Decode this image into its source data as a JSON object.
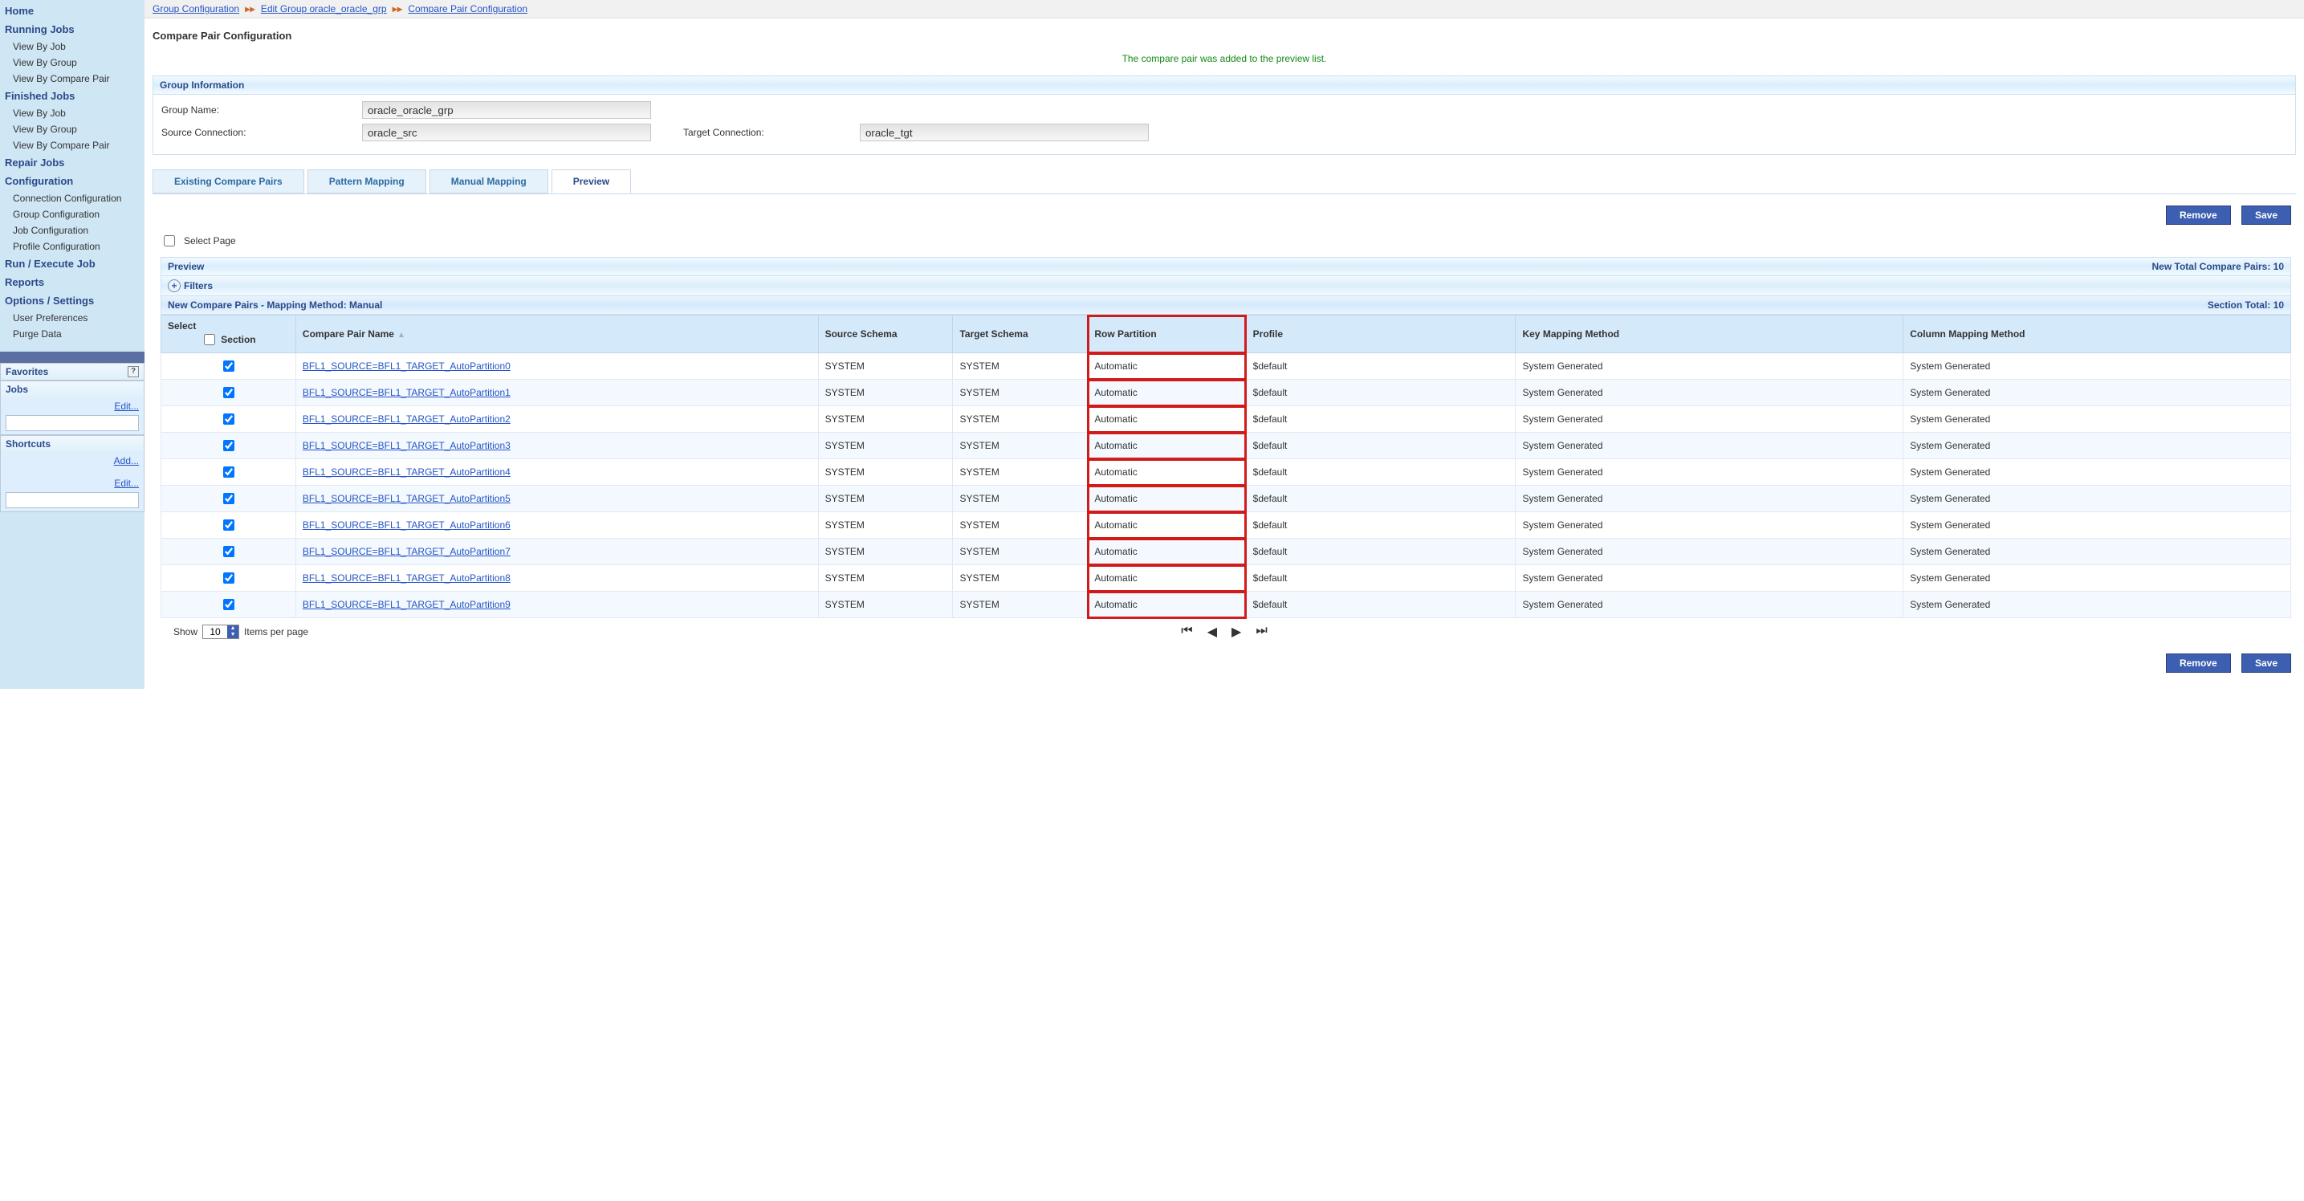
{
  "nav": {
    "home": "Home",
    "running": "Running Jobs",
    "running_items": [
      "View By Job",
      "View By Group",
      "View By Compare Pair"
    ],
    "finished": "Finished Jobs",
    "finished_items": [
      "View By Job",
      "View By Group",
      "View By Compare Pair"
    ],
    "repair": "Repair Jobs",
    "config": "Configuration",
    "config_items": [
      "Connection Configuration",
      "Group Configuration",
      "Job Configuration",
      "Profile Configuration"
    ],
    "run": "Run / Execute Job",
    "reports": "Reports",
    "options": "Options / Settings",
    "options_items": [
      "User Preferences",
      "Purge Data"
    ]
  },
  "side": {
    "favorites": "Favorites",
    "jobs": "Jobs",
    "edit": "Edit...",
    "shortcuts": "Shortcuts",
    "add": "Add..."
  },
  "breadcrumb": {
    "a": "Group Configuration",
    "b": "Edit Group oracle_oracle_grp",
    "c": "Compare Pair Configuration"
  },
  "page_title": "Compare Pair Configuration",
  "notice": "The compare pair was added to the preview list.",
  "group_section": "Group Information",
  "labels": {
    "group_name": "Group Name:",
    "source_conn": "Source Connection:",
    "target_conn": "Target Connection:"
  },
  "values": {
    "group_name": "oracle_oracle_grp",
    "source_conn": "oracle_src",
    "target_conn": "oracle_tgt"
  },
  "tabs": {
    "existing": "Existing Compare Pairs",
    "pattern": "Pattern Mapping",
    "manual": "Manual Mapping",
    "preview": "Preview"
  },
  "buttons": {
    "remove": "Remove",
    "save": "Save"
  },
  "select_page": "Select Page",
  "preview_bar": {
    "left": "Preview",
    "right": "New Total Compare Pairs: 10"
  },
  "filters": "Filters",
  "subhead": {
    "left": "New Compare Pairs - Mapping Method: Manual",
    "right": "Section Total: 10"
  },
  "cols": {
    "select": "Select",
    "section": "Section",
    "name": "Compare Pair Name",
    "src": "Source Schema",
    "tgt": "Target Schema",
    "rp": "Row Partition",
    "profile": "Profile",
    "km": "Key Mapping Method",
    "cm": "Column Mapping Method"
  },
  "rows": [
    {
      "name": "BFL1_SOURCE=BFL1_TARGET_AutoPartition0",
      "src": "SYSTEM",
      "tgt": "SYSTEM",
      "rp": "Automatic",
      "profile": "$default",
      "km": "System Generated",
      "cm": "System Generated"
    },
    {
      "name": "BFL1_SOURCE=BFL1_TARGET_AutoPartition1",
      "src": "SYSTEM",
      "tgt": "SYSTEM",
      "rp": "Automatic",
      "profile": "$default",
      "km": "System Generated",
      "cm": "System Generated"
    },
    {
      "name": "BFL1_SOURCE=BFL1_TARGET_AutoPartition2",
      "src": "SYSTEM",
      "tgt": "SYSTEM",
      "rp": "Automatic",
      "profile": "$default",
      "km": "System Generated",
      "cm": "System Generated"
    },
    {
      "name": "BFL1_SOURCE=BFL1_TARGET_AutoPartition3",
      "src": "SYSTEM",
      "tgt": "SYSTEM",
      "rp": "Automatic",
      "profile": "$default",
      "km": "System Generated",
      "cm": "System Generated"
    },
    {
      "name": "BFL1_SOURCE=BFL1_TARGET_AutoPartition4",
      "src": "SYSTEM",
      "tgt": "SYSTEM",
      "rp": "Automatic",
      "profile": "$default",
      "km": "System Generated",
      "cm": "System Generated"
    },
    {
      "name": "BFL1_SOURCE=BFL1_TARGET_AutoPartition5",
      "src": "SYSTEM",
      "tgt": "SYSTEM",
      "rp": "Automatic",
      "profile": "$default",
      "km": "System Generated",
      "cm": "System Generated"
    },
    {
      "name": "BFL1_SOURCE=BFL1_TARGET_AutoPartition6",
      "src": "SYSTEM",
      "tgt": "SYSTEM",
      "rp": "Automatic",
      "profile": "$default",
      "km": "System Generated",
      "cm": "System Generated"
    },
    {
      "name": "BFL1_SOURCE=BFL1_TARGET_AutoPartition7",
      "src": "SYSTEM",
      "tgt": "SYSTEM",
      "rp": "Automatic",
      "profile": "$default",
      "km": "System Generated",
      "cm": "System Generated"
    },
    {
      "name": "BFL1_SOURCE=BFL1_TARGET_AutoPartition8",
      "src": "SYSTEM",
      "tgt": "SYSTEM",
      "rp": "Automatic",
      "profile": "$default",
      "km": "System Generated",
      "cm": "System Generated"
    },
    {
      "name": "BFL1_SOURCE=BFL1_TARGET_AutoPartition9",
      "src": "SYSTEM",
      "tgt": "SYSTEM",
      "rp": "Automatic",
      "profile": "$default",
      "km": "System Generated",
      "cm": "System Generated"
    }
  ],
  "pager": {
    "show": "Show",
    "per_page": "10",
    "items": "Items per page"
  }
}
